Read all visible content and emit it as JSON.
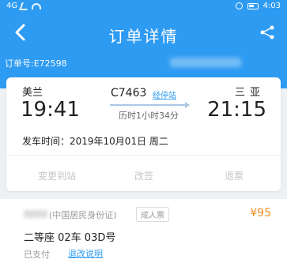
{
  "status_bar": {
    "time": "4:03",
    "network": "4G"
  },
  "nav": {
    "title": "订单详情"
  },
  "order": {
    "number_label": "订单号:E72598"
  },
  "trip": {
    "from_station": "美兰",
    "to_station": "三亚",
    "depart_time": "19:41",
    "arrive_time": "21:15",
    "train_no": "C7463",
    "stopover_link": "经停站",
    "duration": "历时1小时34分",
    "depart_date": "发车时间：2019年10月01日 周二"
  },
  "actions": [
    "变更到站",
    "改签",
    "退票"
  ],
  "passenger": {
    "id_type": "(中国居民身份证)",
    "ticket_type": "成人票",
    "price": "¥95",
    "seat": "二等座 02车 03D号",
    "pay_status": "已支付",
    "refund_link": "退改说明"
  }
}
